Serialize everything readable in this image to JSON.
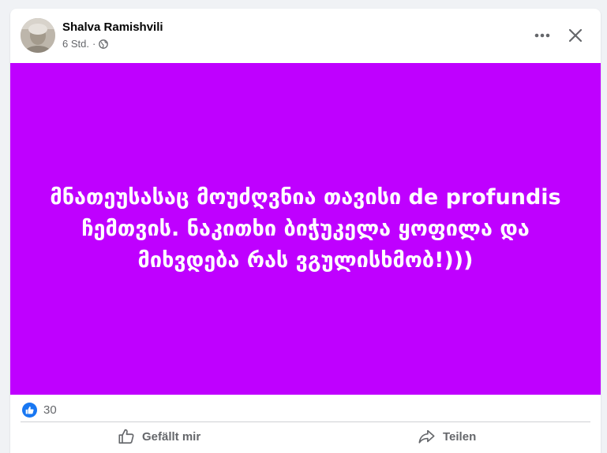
{
  "post": {
    "author": "Shalva Ramishvili",
    "time": "6 Std.",
    "separator": "·",
    "privacy_icon": "globe-icon",
    "text": "მნათეუსასაც მოუძღვნია თავისი de profundis ჩემთვის. ნაკითხი ბიჭუკელა ყოფილა და მიხვდება რას ვგულისხმობ!)))",
    "background_color": "#bf00ff",
    "text_color": "#ffffff"
  },
  "header_actions": {
    "more_icon": "more-horizontal-icon",
    "close_icon": "close-icon"
  },
  "reactions": {
    "icon": "like-reaction-icon",
    "count": "30",
    "color": "#1877f2"
  },
  "actions": {
    "like_label": "Gefällt mir",
    "share_label": "Teilen"
  }
}
